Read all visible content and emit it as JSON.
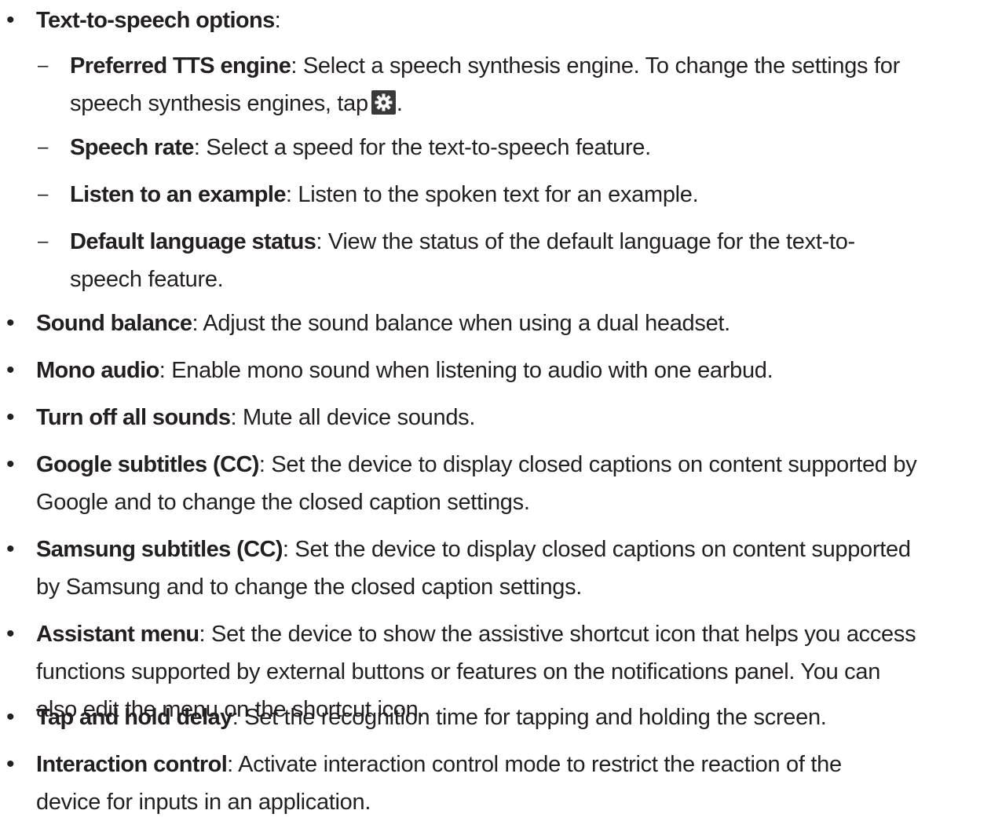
{
  "items": [
    {
      "bold": "Text-to-speech options",
      "rest": ":"
    },
    {
      "bold": "Preferred TTS engine",
      "rest_a": ": Select a speech synthesis engine. To change the settings for",
      "rest_b": "speech synthesis engines, tap",
      "rest_c": ".",
      "icon": "settings-gear-icon"
    },
    {
      "bold": "Speech rate",
      "rest": ": Select a speed for the text-to-speech feature."
    },
    {
      "bold": "Listen to an example",
      "rest": ": Listen to the spoken text for an example."
    },
    {
      "bold": "Default language status",
      "rest_a": ": View the status of the default language for the text-to-",
      "rest_b": "speech feature."
    },
    {
      "bold": "Sound balance",
      "rest": ": Adjust the sound balance when using a dual headset."
    },
    {
      "bold": "Mono audio",
      "rest": ": Enable mono sound when listening to audio with one earbud."
    },
    {
      "bold": "Turn off all sounds",
      "rest": ": Mute all device sounds."
    },
    {
      "bold": "Google subtitles (CC)",
      "rest_a": ": Set the device to display closed captions on content supported by",
      "rest_b": "Google and to change the closed caption settings."
    },
    {
      "bold": "Samsung subtitles (CC)",
      "rest_a": ": Set the device to display closed captions on content supported",
      "rest_b": "by Samsung and to change the closed caption settings."
    },
    {
      "bold": "Assistant menu",
      "rest_a": ": Set the device to show the assistive shortcut icon that helps you access",
      "rest_b": "functions supported by external buttons or features on the notifications panel. You can",
      "rest_c": "also edit the menu on the shortcut icon."
    },
    {
      "bold": "Tap and hold delay",
      "rest": ": Set the recognition time for tapping and holding the screen."
    },
    {
      "bold": "Interaction control",
      "rest_a": ": Activate interaction control mode to restrict the reaction of the",
      "rest_b": "device for inputs in an application."
    }
  ],
  "markers": {
    "bullet": "•",
    "dash": "–"
  },
  "colors": {
    "text": "#231f20",
    "icon_bg": "#3a3a3a",
    "icon_fg": "#ffffff"
  }
}
